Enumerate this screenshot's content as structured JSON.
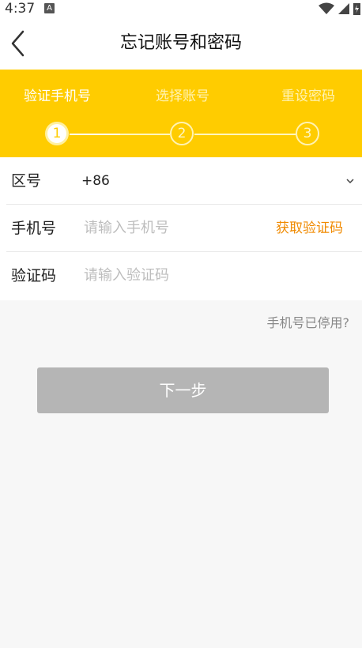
{
  "status_bar": {
    "time": "4:37",
    "notification_badge": "A"
  },
  "header": {
    "title": "忘记账号和密码"
  },
  "steps": [
    {
      "label": "验证手机号",
      "number": "1",
      "active": true
    },
    {
      "label": "选择账号",
      "number": "2",
      "active": false
    },
    {
      "label": "重设密码",
      "number": "3",
      "active": false
    }
  ],
  "form": {
    "region": {
      "label": "区号",
      "value": "+86"
    },
    "phone": {
      "label": "手机号",
      "placeholder": "请输入手机号",
      "get_code": "获取验证码"
    },
    "code": {
      "label": "验证码",
      "placeholder": "请输入验证码"
    }
  },
  "phone_disabled_link": "手机号已停用?",
  "next_button": "下一步",
  "colors": {
    "accent": "#ffcc00",
    "link": "#f08a00",
    "button_disabled": "#b5b5b5",
    "page_bg": "#f7f7f7"
  }
}
